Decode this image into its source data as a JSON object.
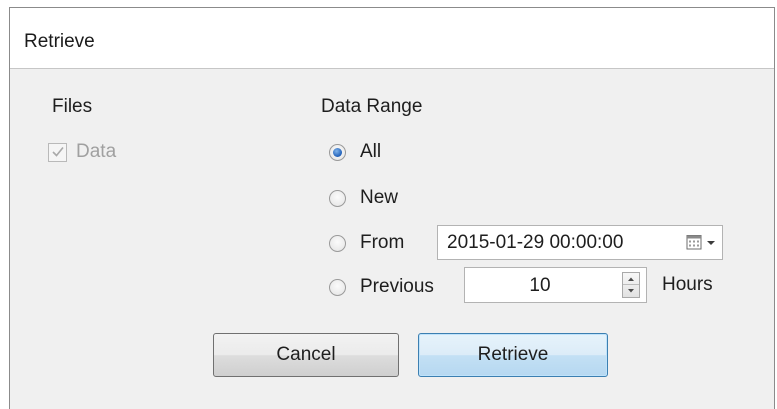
{
  "window": {
    "title": "Retrieve"
  },
  "files": {
    "group_label": "Files",
    "data_checkbox": {
      "label": "Data",
      "checked": true,
      "enabled": false
    }
  },
  "data_range": {
    "group_label": "Data Range",
    "options": [
      {
        "label": "All",
        "selected": true
      },
      {
        "label": "New",
        "selected": false
      },
      {
        "label": "From",
        "selected": false
      },
      {
        "label": "Previous",
        "selected": false
      }
    ],
    "from_datetime": "2015-01-29 00:00:00",
    "previous_value": "10",
    "previous_unit": "Hours"
  },
  "buttons": {
    "cancel": "Cancel",
    "retrieve": "Retrieve"
  },
  "icons": {
    "calendar": "calendar-icon",
    "dropdown": "chevron-down-icon",
    "spin_up": "arrow-up-icon",
    "spin_down": "arrow-down-icon",
    "checkmark": "checkmark-icon"
  },
  "colors": {
    "radio_selected": "#1f5fb8",
    "default_button_border": "#3c7fb1",
    "disabled_text": "#a0a0a0"
  }
}
